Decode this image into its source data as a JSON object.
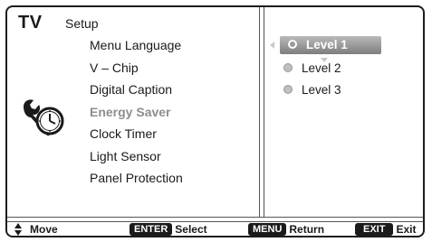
{
  "header": {
    "brand": "TV",
    "section": "Setup"
  },
  "menu": {
    "items": [
      {
        "label": "Menu Language",
        "dimmed": false
      },
      {
        "label": "V – Chip",
        "dimmed": false
      },
      {
        "label": "Digital Caption",
        "dimmed": false
      },
      {
        "label": "Energy Saver",
        "dimmed": true
      },
      {
        "label": "Clock Timer",
        "dimmed": false
      },
      {
        "label": "Light Sensor",
        "dimmed": false
      },
      {
        "label": "Panel Protection",
        "dimmed": false
      }
    ],
    "icon": "wrench-clock-icon"
  },
  "options": {
    "items": [
      {
        "label": "Level 1",
        "selected": true
      },
      {
        "label": "Level 2",
        "selected": false
      },
      {
        "label": "Level 3",
        "selected": false
      }
    ]
  },
  "footer": {
    "move_label": "Move",
    "enter_key": "ENTER",
    "enter_label": "Select",
    "menu_key": "MENU",
    "menu_label": "Return",
    "exit_key": "EXIT",
    "exit_label": "Exit"
  },
  "colors": {
    "selected_bg": "#8f8f8f",
    "dimmed_text": "#8e8e8e",
    "frame": "#1c1c1c"
  }
}
